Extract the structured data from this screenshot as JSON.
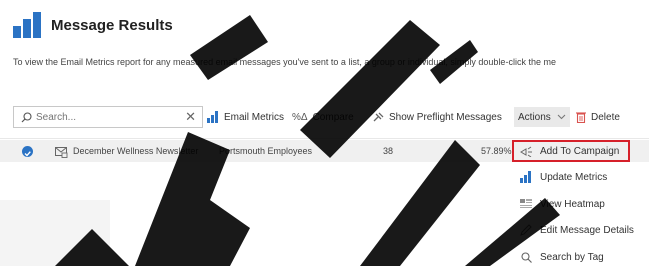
{
  "header": {
    "title": "Message Results"
  },
  "info_text": "To view the Email Metrics report for any measured email messages you've sent to a list, a group or individual, simply double-click the me",
  "toolbar": {
    "search_placeholder": "Search...",
    "clear_glyph": "✕",
    "email_metrics_label": "Email Metrics",
    "compare_label": "Compare",
    "compare_icon": "%Δ",
    "show_preflight_label": "Show Preflight Messages",
    "actions_label": "Actions",
    "delete_label": "Delete"
  },
  "table": {
    "rows": [
      {
        "name": "December Wellness Newsletter",
        "group": "Portsmouth Employees",
        "count": "38",
        "rate": "57.89%"
      }
    ]
  },
  "actions_menu": {
    "items": [
      {
        "label": "Add To Campaign",
        "icon": "campaign-icon",
        "highlighted": true
      },
      {
        "label": "Update Metrics",
        "icon": "bar-chart-icon"
      },
      {
        "label": "View Heatmap",
        "icon": "heatmap-icon"
      },
      {
        "label": "Edit Message Details",
        "icon": "pencil-icon"
      },
      {
        "label": "Search by Tag",
        "icon": "search-icon"
      }
    ]
  },
  "colors": {
    "accent": "#2b73c4",
    "highlight_border": "#d6202a",
    "delete_icon": "#d9534f",
    "watermark": "#000000"
  }
}
